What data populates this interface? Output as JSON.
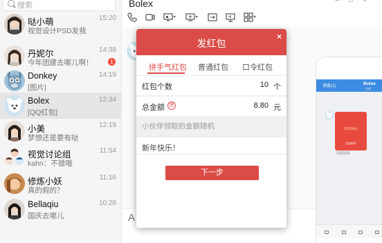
{
  "sidebar": {
    "search_placeholder": "搜索",
    "conversations": [
      {
        "name": "哒小萌",
        "preview": "视觉设计PSD发我",
        "time": "15:20"
      },
      {
        "name": "丹妮尔",
        "preview": "今年团建去哪儿啊！",
        "time": "14:38",
        "badge": "1"
      },
      {
        "name": "Donkey",
        "preview": "[图片]",
        "time": "14:19"
      },
      {
        "name": "Bolex",
        "preview": "[QQ红包]",
        "time": "12:34"
      },
      {
        "name": "小美",
        "preview": "梦想还是要有哒",
        "time": "12:19"
      },
      {
        "name": "视觉讨论组",
        "preview": "kahn：不错哦",
        "time": "11:54"
      },
      {
        "name": "修炼小妖",
        "preview": "真的假的？",
        "time": "11:16"
      },
      {
        "name": "Bellaqiu",
        "preview": "国庆去哪儿",
        "time": "10:28"
      }
    ]
  },
  "chat": {
    "title": "Bolex",
    "input_glyph": "A"
  },
  "dialog": {
    "title": "发红包",
    "close": "×",
    "tabs": [
      "拼手气红包",
      "普通红包",
      "口令红包"
    ],
    "count_label": "红包个数",
    "count_value": "10",
    "count_unit": "个",
    "amount_label": "总金额",
    "amount_badge": "拼",
    "amount_value": "8.80",
    "amount_unit": "元",
    "hint": "小伙伴领取的金额随机",
    "greeting": "新年快乐！",
    "next_button": "下一步"
  },
  "phone": {
    "back_label": "消息(1)",
    "title": "Bolex",
    "subtitle": "在线",
    "envelope_text": "新年快乐!",
    "envelope_label": "点击拆开"
  },
  "colors": {
    "accent_red": "#db4b47",
    "phone_blue": "#3d8ce3"
  }
}
